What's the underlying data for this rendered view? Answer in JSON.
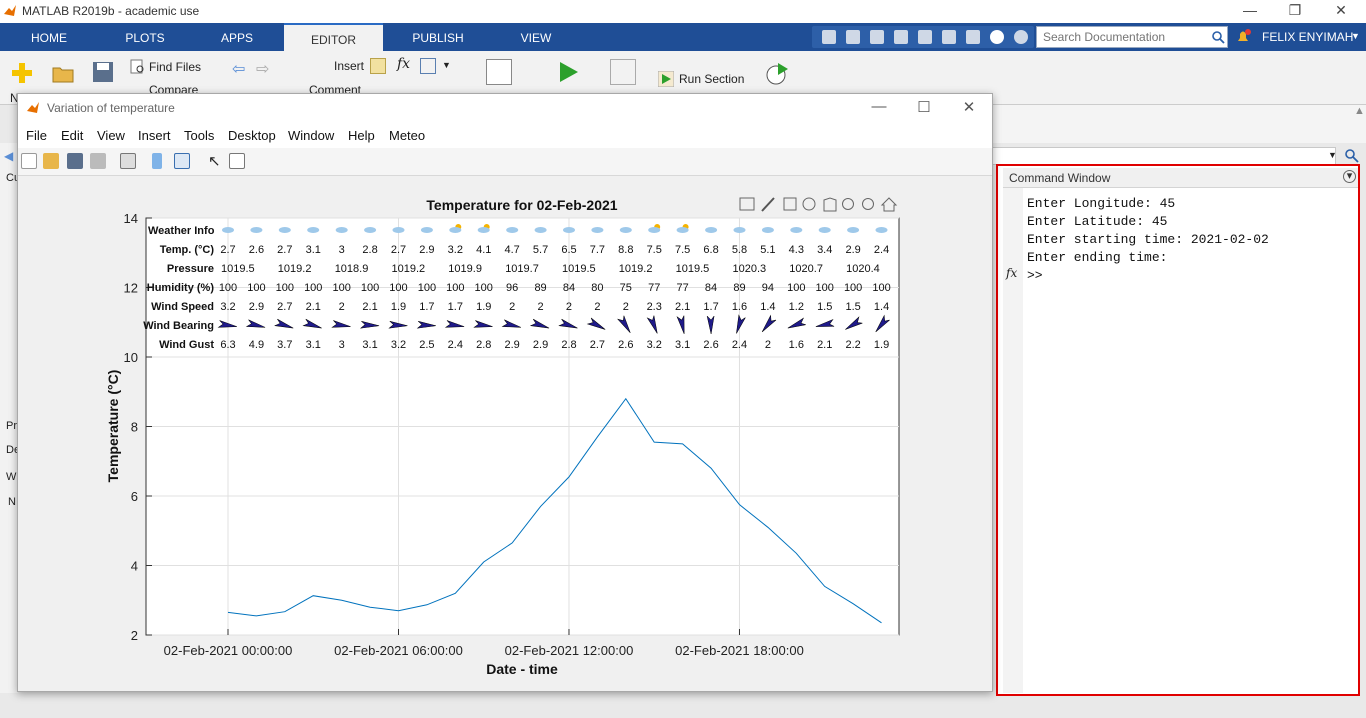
{
  "app": {
    "title": "MATLAB R2019b - academic use"
  },
  "tabs": [
    {
      "label": "HOME"
    },
    {
      "label": "PLOTS"
    },
    {
      "label": "APPS"
    },
    {
      "label": "EDITOR"
    },
    {
      "label": "PUBLISH"
    },
    {
      "label": "VIEW"
    }
  ],
  "search": {
    "placeholder": "Search Documentation"
  },
  "user": {
    "name": "FELIX ENYIMAH"
  },
  "ribbon": {
    "find_files": "Find Files",
    "compare": "Compare",
    "insert": "Insert",
    "comment": "Comment",
    "run_section": "Run Section",
    "new_label": "N"
  },
  "left_panel_labels": [
    "Cu",
    "Pr",
    "De",
    "W",
    "N"
  ],
  "command_window": {
    "title": "Command Window",
    "lines": [
      "Enter Longitude: 45",
      "Enter Latitude: 45",
      "Enter starting time: 2021-02-02",
      "Enter ending time:",
      ">>"
    ],
    "fx": "fx"
  },
  "figure": {
    "window_title": "Variation of temperature",
    "menu": [
      "File",
      "Edit",
      "View",
      "Insert",
      "Tools",
      "Desktop",
      "Window",
      "Help",
      "Meteo"
    ]
  },
  "chart_data": {
    "type": "line",
    "title": "Temperature for 02-Feb-2021",
    "xlabel": "Date - time",
    "ylabel": "Temperature (°C)",
    "ylim": [
      2,
      14
    ],
    "yticks": [
      2,
      4,
      6,
      8,
      10,
      12,
      14
    ],
    "xtick_labels": [
      "02-Feb-2021 00:00:00",
      "02-Feb-2021 06:00:00",
      "02-Feb-2021 12:00:00",
      "02-Feb-2021 18:00:00"
    ],
    "grid": true,
    "series_color": "#0072bd",
    "x_hours": [
      0,
      1,
      2,
      3,
      4,
      5,
      6,
      7,
      8,
      9,
      10,
      11,
      12,
      13,
      14,
      15,
      16,
      17,
      18,
      19,
      20,
      21,
      22,
      23
    ],
    "temperature": [
      2.65,
      2.55,
      2.67,
      3.13,
      3.0,
      2.8,
      2.7,
      2.87,
      3.2,
      4.1,
      4.65,
      5.7,
      6.55,
      7.7,
      8.8,
      7.55,
      7.5,
      6.8,
      5.75,
      5.1,
      4.35,
      3.4,
      2.9,
      2.35
    ],
    "table": {
      "row_labels": [
        "Weather Info",
        "Temp. (°C)",
        "Pressure",
        "Humidity (%)",
        "Wind Speed",
        "Wind Bearing",
        "Wind Gust"
      ],
      "temp": [
        "2.7",
        "2.6",
        "2.7",
        "3.1",
        "3",
        "2.8",
        "2.7",
        "2.9",
        "3.2",
        "4.1",
        "4.7",
        "5.7",
        "6.5",
        "7.7",
        "8.8",
        "7.5",
        "7.5",
        "6.8",
        "5.8",
        "5.1",
        "4.3",
        "3.4",
        "2.9",
        "2.4"
      ],
      "pressure": [
        "1019.5",
        "",
        "1019.2",
        "",
        "1018.9",
        "",
        "1019.2",
        "",
        "1019.9",
        "",
        "1019.7",
        "",
        "1019.5",
        "",
        "1019.2",
        "",
        "1019.5",
        "",
        "1020.3",
        "",
        "1020.7",
        "",
        "1020.4",
        ""
      ],
      "humidity": [
        "100",
        "100",
        "100",
        "100",
        "100",
        "100",
        "100",
        "100",
        "100",
        "100",
        "96",
        "89",
        "84",
        "80",
        "75",
        "77",
        "77",
        "84",
        "89",
        "94",
        "100",
        "100",
        "100",
        "100"
      ],
      "wind_speed": [
        "3.2",
        "2.9",
        "2.7",
        "2.1",
        "2",
        "2.1",
        "1.9",
        "1.7",
        "1.7",
        "1.9",
        "2",
        "2",
        "2",
        "2",
        "2",
        "2.3",
        "2.1",
        "1.7",
        "1.6",
        "1.4",
        "1.2",
        "1.5",
        "1.5",
        "1.4"
      ],
      "wind_bearing_deg": [
        100,
        105,
        110,
        110,
        100,
        95,
        95,
        95,
        100,
        100,
        105,
        110,
        110,
        120,
        150,
        160,
        170,
        180,
        200,
        220,
        250,
        260,
        240,
        220
      ],
      "wind_gust": [
        "6.3",
        "4.9",
        "3.7",
        "3.1",
        "3",
        "3.1",
        "3.2",
        "2.5",
        "2.4",
        "2.8",
        "2.9",
        "2.9",
        "2.8",
        "2.7",
        "2.6",
        "3.2",
        "3.1",
        "2.6",
        "2.4",
        "2",
        "1.6",
        "2.1",
        "2.2",
        "1.9"
      ],
      "weather_icons": [
        "cloud",
        "cloud",
        "cloud",
        "cloud",
        "cloud",
        "cloud",
        "cloud",
        "cloud",
        "partly-sunny",
        "partly-sunny",
        "cloud",
        "cloud",
        "cloud",
        "cloud",
        "cloud",
        "partly-sunny",
        "partly-sunny",
        "cloud",
        "cloud",
        "cloud",
        "cloud",
        "cloud",
        "cloud",
        "cloud"
      ]
    }
  }
}
